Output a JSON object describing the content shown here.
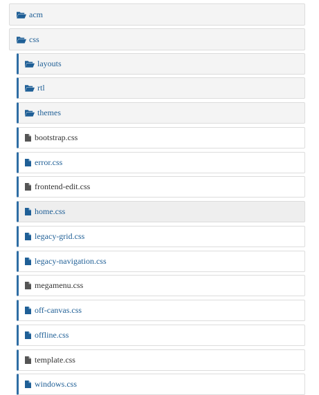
{
  "tree": {
    "colors": {
      "link": "#1f5f96",
      "text": "#333333",
      "accent": "#2e6da4"
    },
    "root_folders": [
      {
        "label": "acm",
        "icon": "folder-open-icon"
      },
      {
        "label": "css",
        "icon": "folder-open-icon",
        "expanded": true
      }
    ],
    "css_children": [
      {
        "label": "layouts",
        "type": "folder",
        "icon": "folder-open-icon"
      },
      {
        "label": "rtl",
        "type": "folder",
        "icon": "folder-open-icon"
      },
      {
        "label": "themes",
        "type": "folder",
        "icon": "folder-open-icon"
      },
      {
        "label": "bootstrap.css",
        "type": "file",
        "icon": "file-icon"
      },
      {
        "label": "error.css",
        "type": "file",
        "icon": "file-icon"
      },
      {
        "label": "frontend-edit.css",
        "type": "file",
        "icon": "file-icon"
      },
      {
        "label": "home.css",
        "type": "file",
        "icon": "file-icon",
        "selected": true
      },
      {
        "label": "legacy-grid.css",
        "type": "file",
        "icon": "file-icon"
      },
      {
        "label": "legacy-navigation.css",
        "type": "file",
        "icon": "file-icon"
      },
      {
        "label": "megamenu.css",
        "type": "file",
        "icon": "file-icon"
      },
      {
        "label": "off-canvas.css",
        "type": "file",
        "icon": "file-icon"
      },
      {
        "label": "offline.css",
        "type": "file",
        "icon": "file-icon"
      },
      {
        "label": "template.css",
        "type": "file",
        "icon": "file-icon"
      },
      {
        "label": "windows.css",
        "type": "file",
        "icon": "file-icon"
      }
    ]
  }
}
